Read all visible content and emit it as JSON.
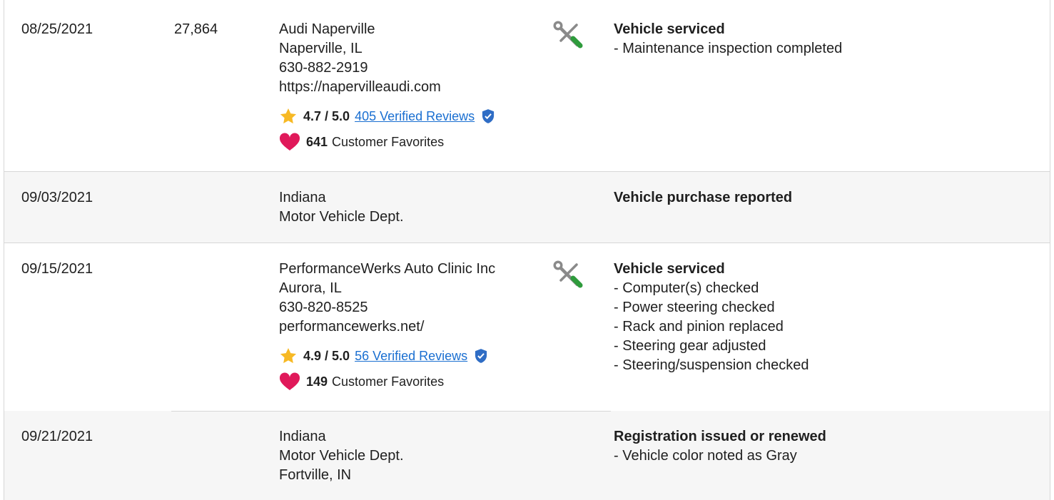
{
  "records": [
    {
      "date": "08/25/2021",
      "mileage": "27,864",
      "source": [
        "Audi Naperville",
        "Naperville, IL",
        "630-882-2919",
        "https://napervilleaudi.com"
      ],
      "rating": "4.7 / 5.0",
      "reviews": "405 Verified Reviews",
      "favorites": "641",
      "favorites_label": "Customer Favorites",
      "detail_title": "Vehicle serviced",
      "details": [
        "- Maintenance inspection completed"
      ]
    },
    {
      "date": "09/03/2021",
      "mileage": "",
      "source": [
        "Indiana",
        "Motor Vehicle Dept."
      ],
      "detail_title": "Vehicle purchase reported",
      "details": []
    },
    {
      "date": "09/15/2021",
      "mileage": "",
      "source": [
        "PerformanceWerks Auto Clinic Inc",
        "Aurora, IL",
        "630-820-8525",
        "performancewerks.net/"
      ],
      "rating": "4.9 / 5.0",
      "reviews": "56 Verified Reviews",
      "favorites": "149",
      "favorites_label": "Customer Favorites",
      "detail_title": "Vehicle serviced",
      "details": [
        "- Computer(s) checked",
        "- Power steering checked",
        "- Rack and pinion replaced",
        "- Steering gear adjusted",
        "- Steering/suspension checked"
      ]
    },
    {
      "date": "09/21/2021",
      "mileage": "",
      "source": [
        "Indiana",
        "Motor Vehicle Dept.",
        "Fortville, IN"
      ],
      "detail_title": "Registration issued or renewed",
      "details": [
        "- Vehicle color noted as Gray"
      ]
    }
  ],
  "colors": {
    "link": "#1a6fd1",
    "star": "#f7b924",
    "heart": "#e0195a",
    "shield": "#2f6dc5",
    "wrench_gray": "#8a8a8a",
    "screwdriver_green": "#2e9b3c",
    "divider": "#d7d7d7"
  },
  "icons": [
    "service-tools-icon",
    "star-icon",
    "verified-shield-icon",
    "heart-icon"
  ]
}
